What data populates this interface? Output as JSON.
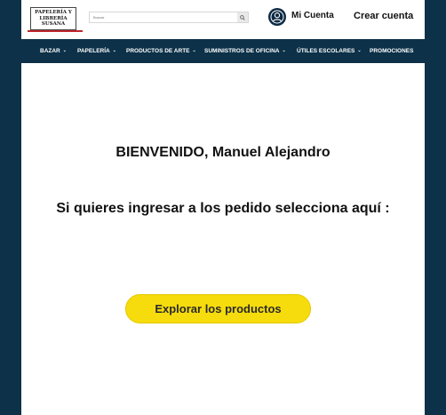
{
  "header": {
    "logo": {
      "line1": "PAPELERÍA Y",
      "line2": "LIBRERÍA",
      "line3": "SUSANA"
    },
    "search": {
      "placeholder": "Buscar",
      "button_icon": "search-icon"
    },
    "account": {
      "icon": "user-icon",
      "label": "Mi Cuenta"
    },
    "create_account": "Crear cuenta"
  },
  "nav": {
    "items": [
      {
        "label": "BAZAR",
        "dropdown": true
      },
      {
        "label": "PAPELERÍA",
        "dropdown": true
      },
      {
        "label": "PRODUCTOS DE ARTE",
        "dropdown": true
      },
      {
        "label": "SUMINISTROS DE OFICINA",
        "dropdown": true
      },
      {
        "label": "ÚTILES ESCOLARES",
        "dropdown": true
      },
      {
        "label": "PROMOCIONES",
        "dropdown": false
      }
    ],
    "chevron": "⌄"
  },
  "main": {
    "welcome": "BIENVENIDO, Manuel Alejandro",
    "prompt": "Si quieres ingresar a los pedido selecciona aquí :",
    "cta_label": "Explorar los productos"
  },
  "colors": {
    "navy": "#0c3148",
    "cta_yellow": "#f6dc0c",
    "logo_accent": "#c0262c"
  }
}
